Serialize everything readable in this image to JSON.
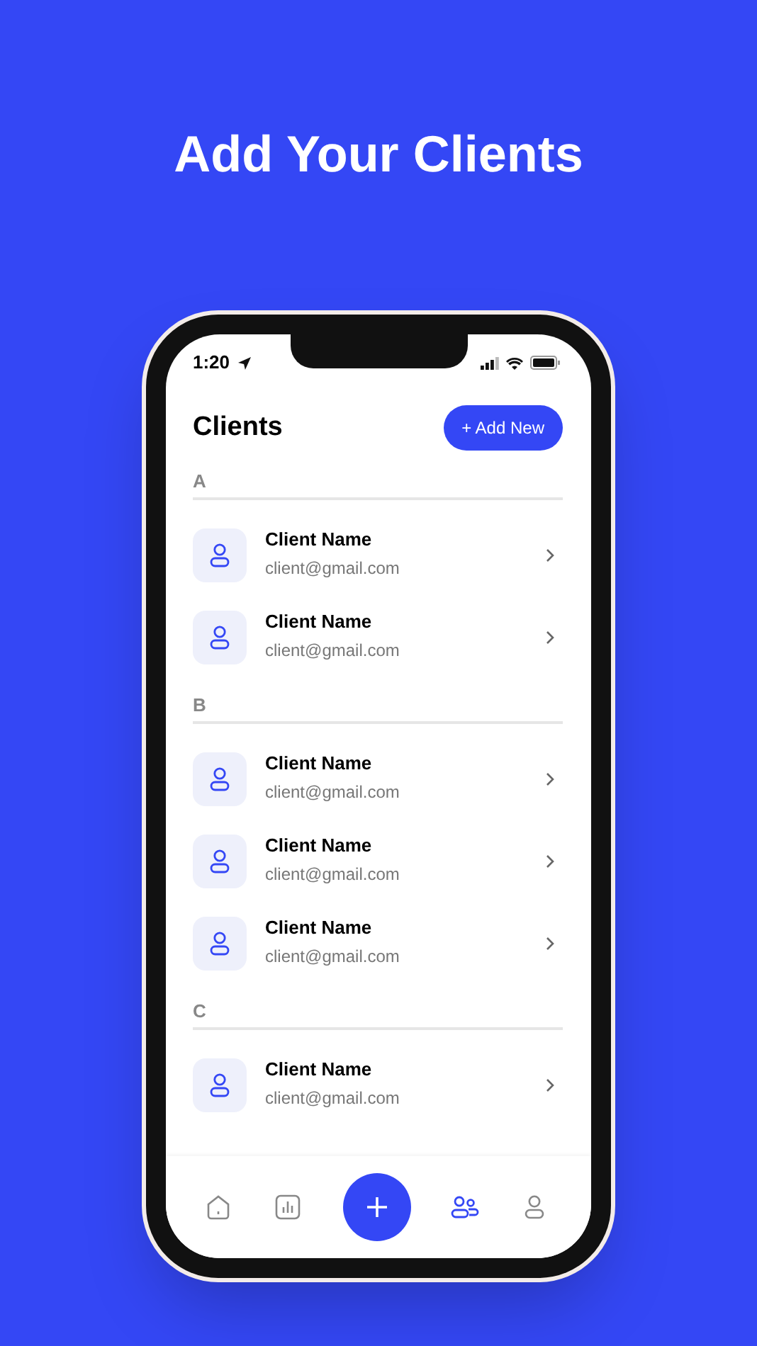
{
  "headline": "Add Your Clients",
  "status_bar": {
    "time": "1:20"
  },
  "header": {
    "title": "Clients",
    "button": "+ Add New"
  },
  "sections": [
    {
      "letter": "A",
      "clients": [
        {
          "name": "Client Name",
          "email": "client@gmail.com"
        },
        {
          "name": "Client Name",
          "email": "client@gmail.com"
        }
      ]
    },
    {
      "letter": "B",
      "clients": [
        {
          "name": "Client Name",
          "email": "client@gmail.com"
        },
        {
          "name": "Client Name",
          "email": "client@gmail.com"
        },
        {
          "name": "Client Name",
          "email": "client@gmail.com"
        }
      ]
    },
    {
      "letter": "C",
      "clients": [
        {
          "name": "Client Name",
          "email": "client@gmail.com"
        }
      ]
    }
  ],
  "bottom_nav": [
    {
      "kind": "home",
      "selected": false
    },
    {
      "kind": "stats",
      "selected": false
    },
    {
      "kind": "add",
      "selected": false
    },
    {
      "kind": "clients",
      "selected": true
    },
    {
      "kind": "profile",
      "selected": false
    }
  ]
}
